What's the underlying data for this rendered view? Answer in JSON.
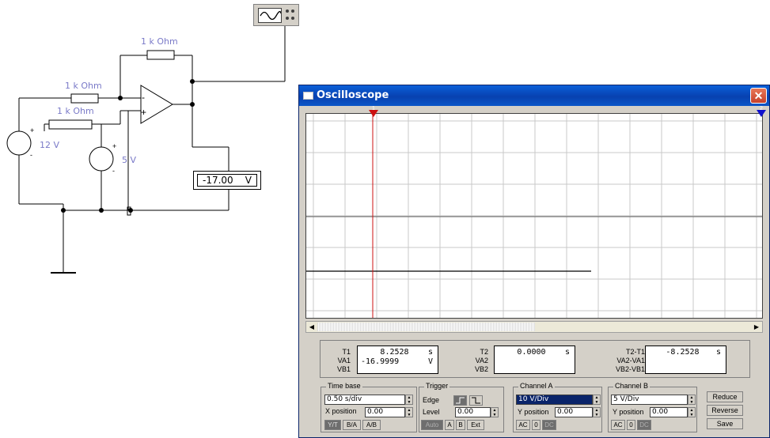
{
  "circuit": {
    "resistor_labels": [
      "1 k Ohm",
      "1 k Ohm",
      "1 k Ohm"
    ],
    "source1": {
      "value": "12 V",
      "plus": "+",
      "minus": "-"
    },
    "source2": {
      "value": "5 V",
      "plus": "+",
      "minus": "-"
    },
    "opamp": {
      "minus": "-",
      "plus": "+"
    },
    "voltmeter": {
      "value": "-17.00",
      "unit": "V"
    }
  },
  "window": {
    "title": "Oscilloscope",
    "close_glyph": "✕",
    "cursor1_tag": "1",
    "cursor2_tag": "2"
  },
  "readouts": {
    "t1": {
      "label": "T1",
      "value": "8.2528",
      "unit": "s"
    },
    "va1": {
      "label": "VA1",
      "value": "-16.9999",
      "unit": "V"
    },
    "vb1": {
      "label": "VB1"
    },
    "t2": {
      "label": "T2",
      "value": "0.0000",
      "unit": "s"
    },
    "va2": {
      "label": "VA2"
    },
    "vb2": {
      "label": "VB2"
    },
    "dt": {
      "label": "T2-T1",
      "value": "-8.2528",
      "unit": "s"
    },
    "dva": {
      "label": "VA2-VA1"
    },
    "dvb": {
      "label": "VB2-VB1"
    }
  },
  "timebase": {
    "title": "Time base",
    "scale": "0.50 s/div",
    "xpos_label": "X position",
    "xpos": "0.00",
    "modes": [
      "Y/T",
      "B/A",
      "A/B"
    ]
  },
  "trigger": {
    "title": "Trigger",
    "edge_label": "Edge",
    "level_label": "Level",
    "level": "0.00",
    "buttons": [
      "Auto",
      "A",
      "B",
      "Ext"
    ]
  },
  "channel_a": {
    "title": "Channel A",
    "scale": "10 V/Div",
    "ypos_label": "Y position",
    "ypos": "0.00",
    "coupling": [
      "AC",
      "0",
      "DC"
    ]
  },
  "channel_b": {
    "title": "Channel B",
    "scale": "5 V/Div",
    "ypos_label": "Y position",
    "ypos": "0.00",
    "coupling": [
      "AC",
      "0",
      "DC"
    ]
  },
  "side_buttons": {
    "reduce": "Reduce",
    "reverse": "Reverse",
    "save": "Save"
  },
  "colors": {
    "cursor1": "#cc1010",
    "cursor2": "#1010cc",
    "trace": "#000000",
    "grid": "#c8c8c8"
  }
}
